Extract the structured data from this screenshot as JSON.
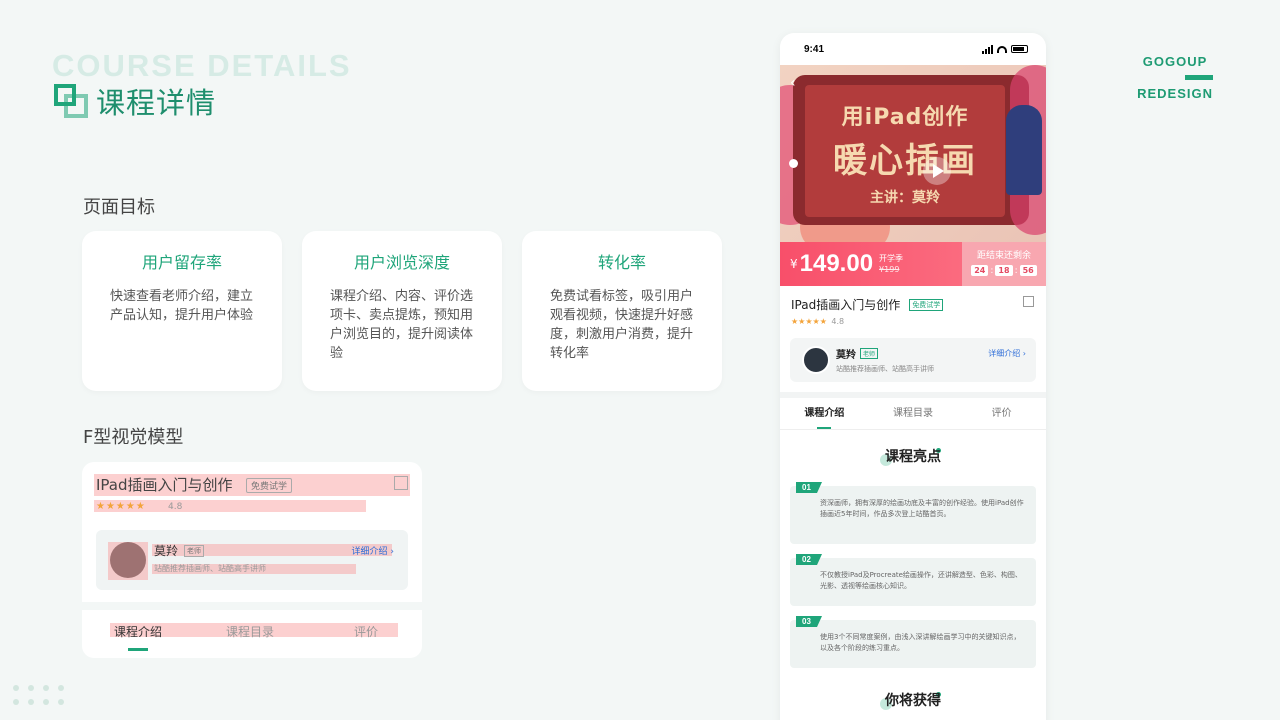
{
  "header": {
    "en_title": "COURSE DETAILS",
    "cn_title": "课程详情"
  },
  "brand": {
    "top": "GOGOUP",
    "bottom": "REDESIGN"
  },
  "goals_section": {
    "label": "页面目标",
    "cards": [
      {
        "title": "用户留存率",
        "desc": "快速查看老师介绍，建立产品认知，提升用户体验"
      },
      {
        "title": "用户浏览深度",
        "desc": "课程介绍、内容、评价选项卡、卖点提炼，预知用户浏览目的，提升阅读体验"
      },
      {
        "title": "转化率",
        "desc": "免费试看标签，吸引用户观看视频，快速提升好感度，刺激用户消费，提升转化率"
      }
    ]
  },
  "fmodel_section": {
    "label": "F型视觉模型",
    "course_title": "IPad插画入门与创作",
    "free_tag": "免费试学",
    "stars": "★★★★★",
    "rating": "4.8",
    "teacher_name": "莫羚",
    "teacher_tag": "老师",
    "teacher_desc": "站酷推荐插画师、站酷高手讲师",
    "detail_link": "详细介绍 ›",
    "tabs": [
      "课程介绍",
      "课程目录",
      "评价"
    ]
  },
  "phone": {
    "time": "9:41",
    "banner": {
      "line1": "用iPad创作",
      "line2": "暖心插画",
      "line3": "主讲：莫羚",
      "back": "‹"
    },
    "price": {
      "currency": "¥",
      "value": "149.00",
      "promo": "开学季",
      "old": "¥199",
      "countdown_label": "距结束还剩余",
      "countdown": [
        "24",
        "18",
        "56"
      ],
      "sep": ":"
    },
    "course": {
      "title": "IPad插画入门与创作",
      "free_tag": "免费试学",
      "stars": "★★★★★",
      "rating": "4.8"
    },
    "teacher": {
      "name": "莫羚",
      "tag": "老师",
      "desc": "站酷推荐插画师、站酷高手讲师",
      "detail": "详细介绍 ›"
    },
    "tabs": [
      "课程介绍",
      "课程目录",
      "评价"
    ],
    "highlights": {
      "heading": "课程亮点",
      "items": [
        {
          "num": "01",
          "text": "资深画师，拥有深厚的绘画功底及丰富的创作经验。使用iPad创作插画近5年时间，作品多次登上站酷首页。"
        },
        {
          "num": "02",
          "text": "不仅教授iPad及Procreate绘画操作，还讲解造型、色彩、构图、光影、透视等绘画核心知识。"
        },
        {
          "num": "03",
          "text": "使用3个不同常度案例，由浅入深讲解绘画学习中的关键知识点，以及各个阶段的练习重点。"
        }
      ]
    },
    "gain_heading": "你将获得"
  }
}
